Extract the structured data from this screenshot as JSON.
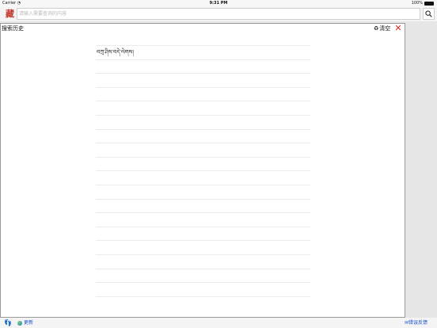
{
  "status_bar": {
    "carrier": "Carrier",
    "time": "9:31 PM",
    "battery": "100%"
  },
  "search": {
    "logo_glyph": "藏",
    "placeholder": "请输入需要查询的内容"
  },
  "history_panel": {
    "title": "搜索历史",
    "clear_label": "清空",
    "items": [
      "བཀྲ་ཤིས་བདེ་ལེགས།",
      "",
      "",
      "",
      "",
      "",
      "",
      "",
      "",
      "",
      "",
      "",
      "",
      "",
      "",
      "",
      "",
      "",
      ""
    ]
  },
  "bottom_bar": {
    "update_label": "更新",
    "feedback_label": "✉错误反馈"
  },
  "colors": {
    "accent_red": "#d9271e",
    "link_blue": "#1a53c9"
  }
}
